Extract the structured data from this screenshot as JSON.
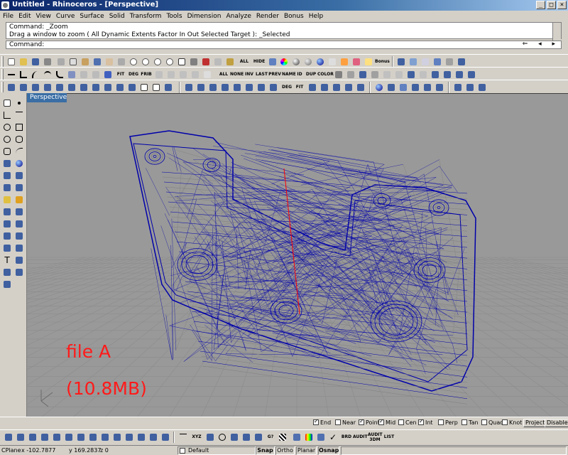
{
  "window": {
    "title": "Untitled - Rhinoceros - [Perspective]",
    "controls": [
      "_",
      "□",
      "×"
    ]
  },
  "menu": [
    "File",
    "Edit",
    "View",
    "Curve",
    "Surface",
    "Solid",
    "Transform",
    "Tools",
    "Dimension",
    "Analyze",
    "Render",
    "Bonus",
    "Help"
  ],
  "command": {
    "history_line1": "Command: _Zoom",
    "history_line2": "Drag a window to zoom ( All  Dynamic  Extents  Factor  In  Out  Selected  Target ): _Selected",
    "prompt": "Command:",
    "arrows": "⇐ ◂ ▸"
  },
  "toolbar_text": {
    "all": "ALL",
    "hide": "HIDE",
    "bonus": "Bonus",
    "fit": "FIT",
    "deg": "DEG",
    "frib": "FRIB",
    "all2": "ALL",
    "none": "NONE",
    "inv": "INV",
    "last": "LAST",
    "prev": "PREV",
    "name": "NAME",
    "id": "ID",
    "dup": "DUP",
    "color": "COLOR",
    "deg2": "DEG",
    "fit2": "FIT"
  },
  "viewport": {
    "name": "Perspective",
    "overlay_line1": "file A",
    "overlay_line2": "(10.8MB)",
    "wire_color": "#0000aa",
    "gray_color": "#7f7f7f",
    "axis_color": "#ff0000"
  },
  "osnap": {
    "items": [
      {
        "label": "End",
        "checked": true
      },
      {
        "label": "Near",
        "checked": false
      },
      {
        "label": "Point",
        "checked": true
      },
      {
        "label": "Mid",
        "checked": true
      },
      {
        "label": "Cen",
        "checked": false
      },
      {
        "label": "Int",
        "checked": true
      },
      {
        "label": "Perp",
        "checked": false
      },
      {
        "label": "Tan",
        "checked": false
      },
      {
        "label": "Quad",
        "checked": false
      },
      {
        "label": "Knot",
        "checked": false
      }
    ],
    "project": "Project",
    "disable": "Disable"
  },
  "bottom_text": {
    "xyz": "XYZ",
    "audit": "AUDIT",
    "brd": "BRD",
    "audit3dm": "AUDIT 3DM",
    "list": "LIST",
    "g": "G?"
  },
  "status": {
    "cplane": "CPlane",
    "x": "x -102.7877",
    "y": "y 169.2837",
    "z": "z 0",
    "layer": "Default",
    "snap": "Snap",
    "ortho": "Ortho",
    "planar": "Planar",
    "osnap": "Osnap"
  }
}
